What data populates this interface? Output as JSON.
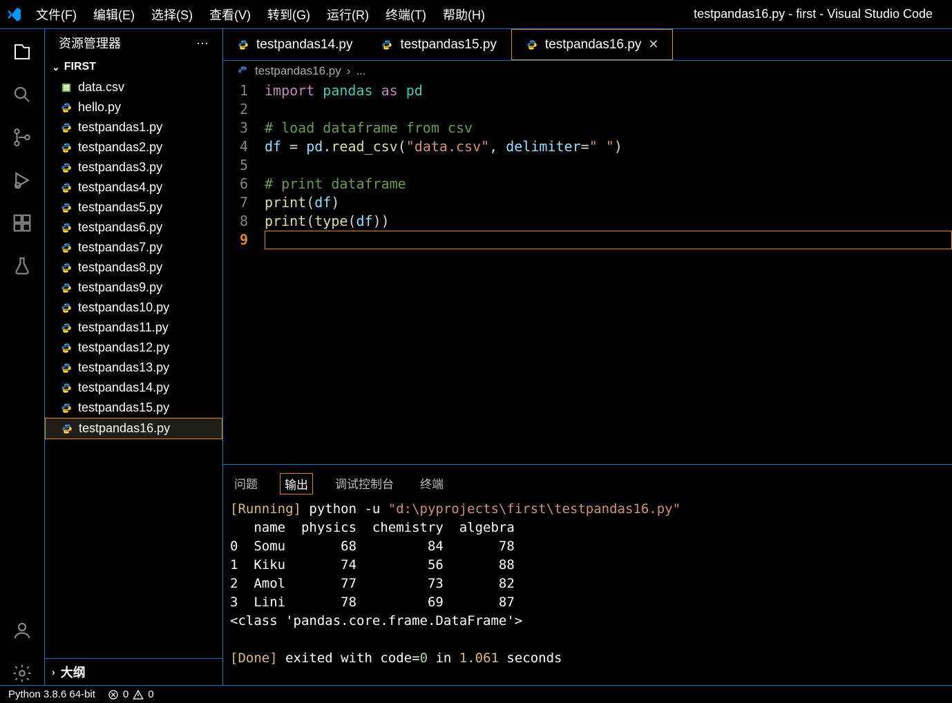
{
  "window_title": "testpandas16.py - first - Visual Studio Code",
  "menu": [
    "文件(F)",
    "编辑(E)",
    "选择(S)",
    "查看(V)",
    "转到(G)",
    "运行(R)",
    "终端(T)",
    "帮助(H)"
  ],
  "sidebar": {
    "title": "资源管理器",
    "folder": "FIRST",
    "files": [
      {
        "name": "data.csv",
        "icon": "csv"
      },
      {
        "name": "hello.py",
        "icon": "py"
      },
      {
        "name": "testpandas1.py",
        "icon": "py"
      },
      {
        "name": "testpandas2.py",
        "icon": "py"
      },
      {
        "name": "testpandas3.py",
        "icon": "py"
      },
      {
        "name": "testpandas4.py",
        "icon": "py"
      },
      {
        "name": "testpandas5.py",
        "icon": "py"
      },
      {
        "name": "testpandas6.py",
        "icon": "py"
      },
      {
        "name": "testpandas7.py",
        "icon": "py"
      },
      {
        "name": "testpandas8.py",
        "icon": "py"
      },
      {
        "name": "testpandas9.py",
        "icon": "py"
      },
      {
        "name": "testpandas10.py",
        "icon": "py"
      },
      {
        "name": "testpandas11.py",
        "icon": "py"
      },
      {
        "name": "testpandas12.py",
        "icon": "py"
      },
      {
        "name": "testpandas13.py",
        "icon": "py"
      },
      {
        "name": "testpandas14.py",
        "icon": "py"
      },
      {
        "name": "testpandas15.py",
        "icon": "py"
      },
      {
        "name": "testpandas16.py",
        "icon": "py",
        "active": true
      }
    ],
    "outline": "大纲"
  },
  "tabs": [
    {
      "label": "testpandas14.py",
      "active": false
    },
    {
      "label": "testpandas15.py",
      "active": false
    },
    {
      "label": "testpandas16.py",
      "active": true
    }
  ],
  "breadcrumb": {
    "file": "testpandas16.py",
    "more": "..."
  },
  "code": {
    "lines": [
      {
        "n": 1,
        "html": "<span class='kw'>import</span> <span class='mod'>pandas</span> <span class='kw'>as</span> <span class='mod'>pd</span>"
      },
      {
        "n": 2,
        "html": ""
      },
      {
        "n": 3,
        "html": "<span class='cmt'># load dataframe from csv</span>"
      },
      {
        "n": 4,
        "html": "<span class='var'>df</span> <span class='punct'>=</span> <span class='var'>pd</span><span class='punct'>.</span><span class='fn'>read_csv</span><span class='punct'>(</span><span class='str'>\"data.csv\"</span><span class='punct'>,</span> <span class='var'>delimiter</span><span class='punct'>=</span><span class='str'>\" \"</span><span class='punct'>)</span>"
      },
      {
        "n": 5,
        "html": ""
      },
      {
        "n": 6,
        "html": "<span class='cmt'># print dataframe</span>"
      },
      {
        "n": 7,
        "html": "<span class='bfn'>print</span><span class='punct'>(</span><span class='var'>df</span><span class='punct'>)</span>"
      },
      {
        "n": 8,
        "html": "<span class='bfn'>print</span><span class='punct'>(</span><span class='bfn'>type</span><span class='punct'>(</span><span class='var'>df</span><span class='punct'>))</span>"
      },
      {
        "n": 9,
        "html": "",
        "active": true
      }
    ]
  },
  "panel": {
    "tabs": [
      "问题",
      "输出",
      "调试控制台",
      "终端"
    ],
    "active_tab": 1,
    "output": {
      "running_label": "[Running]",
      "running_cmd": " python -u ",
      "running_path": "\"d:\\pyprojects\\first\\testpandas16.py\"",
      "table_header": "   name  physics  chemistry  algebra",
      "table_rows": [
        "0  Somu       68         84       78",
        "1  Kiku       74         56       88",
        "2  Amol       77         73       82",
        "3  Lini       78         69       87"
      ],
      "class_line": "<class 'pandas.core.frame.DataFrame'>",
      "done_label": "[Done]",
      "done_text": " exited with ",
      "done_code_label": "code=",
      "done_code": "0",
      "done_in": " in ",
      "done_time": "1.061",
      "done_seconds": " seconds"
    }
  },
  "status": {
    "python": "Python 3.8.6 64-bit",
    "errors": "0",
    "warnings": "0"
  }
}
